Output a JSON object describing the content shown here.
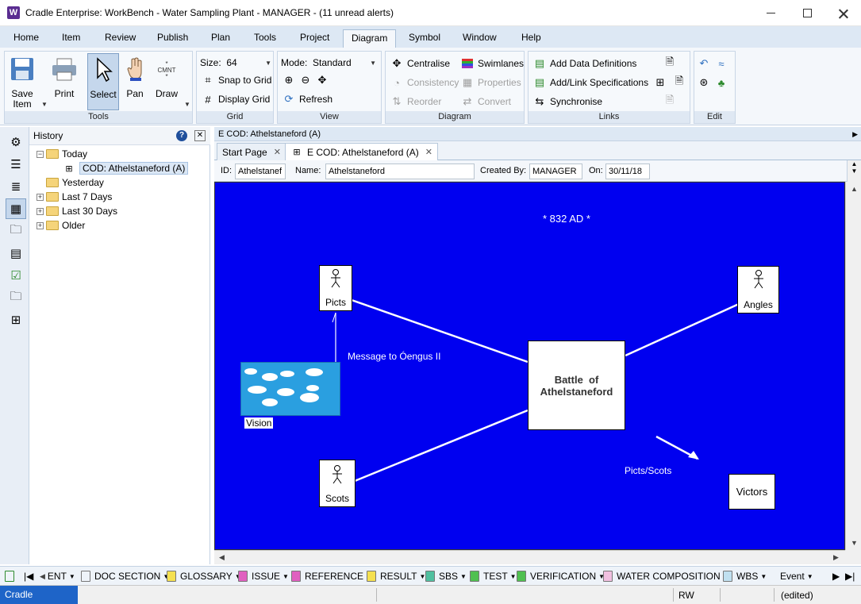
{
  "window": {
    "title": "Cradle Enterprise: WorkBench - Water Sampling Plant - MANAGER - (11 unread alerts)",
    "app_icon_letter": "W"
  },
  "menu": {
    "tabs": [
      "Home",
      "Item",
      "Review",
      "Publish",
      "Plan",
      "Tools",
      "Project",
      "Diagram",
      "Symbol",
      "Window",
      "Help"
    ],
    "active": "Diagram"
  },
  "ribbon": {
    "save_item": "Save\nItem",
    "save_label_1": "Save",
    "save_label_2": "Item",
    "print": "Print",
    "select": "Select",
    "pan": "Pan",
    "draw": "Draw",
    "draw_icon_text": "CMNT",
    "tools_group": "Tools",
    "size_label": "Size:",
    "size_value": "64",
    "snap_to_grid": "Snap to Grid",
    "display_grid": "Display Grid",
    "grid_group": "Grid",
    "mode_label": "Mode:",
    "mode_value": "Standard",
    "refresh": "Refresh",
    "view_group": "View",
    "centralise": "Centralise",
    "swimlanes": "Swimlanes",
    "consistency": "Consistency",
    "properties": "Properties",
    "reorder": "Reorder",
    "convert": "Convert",
    "diagram_group": "Diagram",
    "add_data_definitions": "Add Data Definitions",
    "add_link_specifications": "Add/Link Specifications",
    "synchronise": "Synchronise",
    "links_group": "Links",
    "edit_group": "Edit"
  },
  "history": {
    "title": "History",
    "help": "?",
    "close": "✕",
    "nodes": [
      {
        "label": "Today",
        "expander": "−"
      },
      {
        "label": "COD: Athelstaneford (A)"
      },
      {
        "label": "Yesterday"
      },
      {
        "label": "Last 7 Days",
        "expander": "+"
      },
      {
        "label": "Last 30 Days",
        "expander": "+"
      },
      {
        "label": "Older",
        "expander": "+"
      }
    ]
  },
  "document": {
    "breadcrumb": "E COD: Athelstaneford (A)",
    "tabs": [
      {
        "label": "Start Page",
        "close": "✕"
      },
      {
        "label": "E COD: Athelstaneford (A)",
        "close": "✕"
      }
    ],
    "id_label": "ID:",
    "id_value": "Athelstanef",
    "name_label": "Name:",
    "name_value": "Athelstaneford",
    "created_by_label": "Created By:",
    "created_by_value": "MANAGER",
    "on_label": "On:",
    "on_value": "30/11/18"
  },
  "diagram": {
    "background": "#0000f0",
    "date_text": "* 832 AD *",
    "picts": "Picts",
    "angles": "Angles",
    "scots": "Scots",
    "battle_line1": "Battle  of",
    "battle_line2": "Athelstaneford",
    "vision": "Vision",
    "message": "Message to  Óengus II",
    "picts_scots": "Picts/Scots",
    "victors": "Victors"
  },
  "bottom_toolbar": {
    "items": [
      "ENT",
      "DOC SECTION",
      "GLOSSARY",
      "ISSUE",
      "REFERENCE",
      "RESULT",
      "SBS",
      "TEST",
      "VERIFICATION",
      "WATER COMPOSITION",
      "WBS",
      "Event"
    ]
  },
  "status": {
    "app": "Cradle Enterprise",
    "rw": "RW",
    "edited": "(edited)"
  },
  "colors": {
    "accent": "#1e64c8",
    "canvas": "#0000f0"
  }
}
